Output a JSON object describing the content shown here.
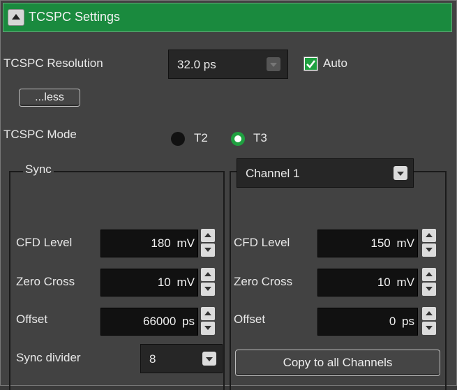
{
  "header": {
    "title": "TCSPC Settings",
    "collapse_icon": "collapse-up-icon"
  },
  "resolution": {
    "label": "TCSPC Resolution",
    "value": "32.0 ps",
    "auto_label": "Auto",
    "auto_checked": true
  },
  "less_button": "...less",
  "mode": {
    "label": "TCSPC Mode",
    "options": [
      "T2",
      "T3"
    ],
    "selected": "T3"
  },
  "sync": {
    "title": "Sync",
    "cfd_label": "CFD Level",
    "cfd_value": "180",
    "cfd_unit": "mV",
    "zero_label": "Zero Cross",
    "zero_value": "10",
    "zero_unit": "mV",
    "offset_label": "Offset",
    "offset_value": "66000",
    "offset_unit": "ps",
    "divider_label": "Sync divider",
    "divider_value": "8"
  },
  "channel": {
    "selected": "Channel 1",
    "cfd_label": "CFD Level",
    "cfd_value": "150",
    "cfd_unit": "mV",
    "zero_label": "Zero Cross",
    "zero_value": "10",
    "zero_unit": "mV",
    "offset_label": "Offset",
    "offset_value": "0",
    "offset_unit": "ps",
    "copy_button": "Copy to all Channels"
  },
  "colors": {
    "header": "#1a8a3e",
    "background": "#424242",
    "accent": "#1fa040"
  }
}
